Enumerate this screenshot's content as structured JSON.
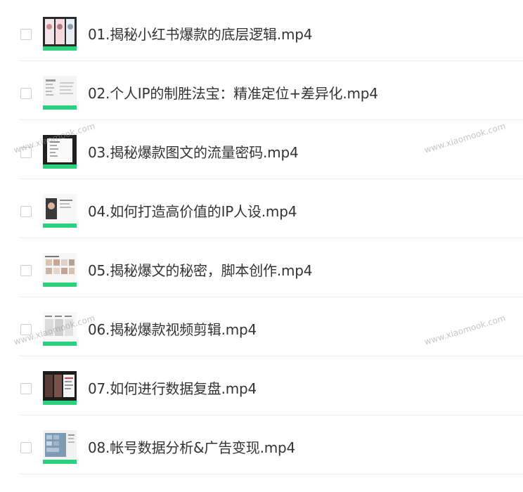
{
  "files": [
    {
      "name": "01.揭秘小红书爆款的底层逻辑.mp4",
      "thumb_icon": "video-thumbnail-icon"
    },
    {
      "name": "02.个人IP的制胜法宝：精准定位+差异化.mp4",
      "thumb_icon": "video-thumbnail-icon"
    },
    {
      "name": "03.揭秘爆款图文的流量密码.mp4",
      "thumb_icon": "video-thumbnail-icon"
    },
    {
      "name": "04.如何打造高价值的IP人设.mp4",
      "thumb_icon": "video-thumbnail-icon"
    },
    {
      "name": "05.揭秘爆文的秘密，脚本创作.mp4",
      "thumb_icon": "video-thumbnail-icon"
    },
    {
      "name": "06.揭秘爆款视频剪辑.mp4",
      "thumb_icon": "video-thumbnail-icon"
    },
    {
      "name": "07.如何进行数据复盘.mp4",
      "thumb_icon": "video-thumbnail-icon"
    },
    {
      "name": "08.帐号数据分析&广告变现.mp4",
      "thumb_icon": "video-thumbnail-icon"
    }
  ],
  "watermark": {
    "left_text": "www.xiaomook.com",
    "right_text": "www.xiaomook.com"
  },
  "colors": {
    "text": "#333333",
    "divider": "#ececec",
    "checkbox_border": "#cfcfcf",
    "thumb_accent": "#2bd17e"
  }
}
